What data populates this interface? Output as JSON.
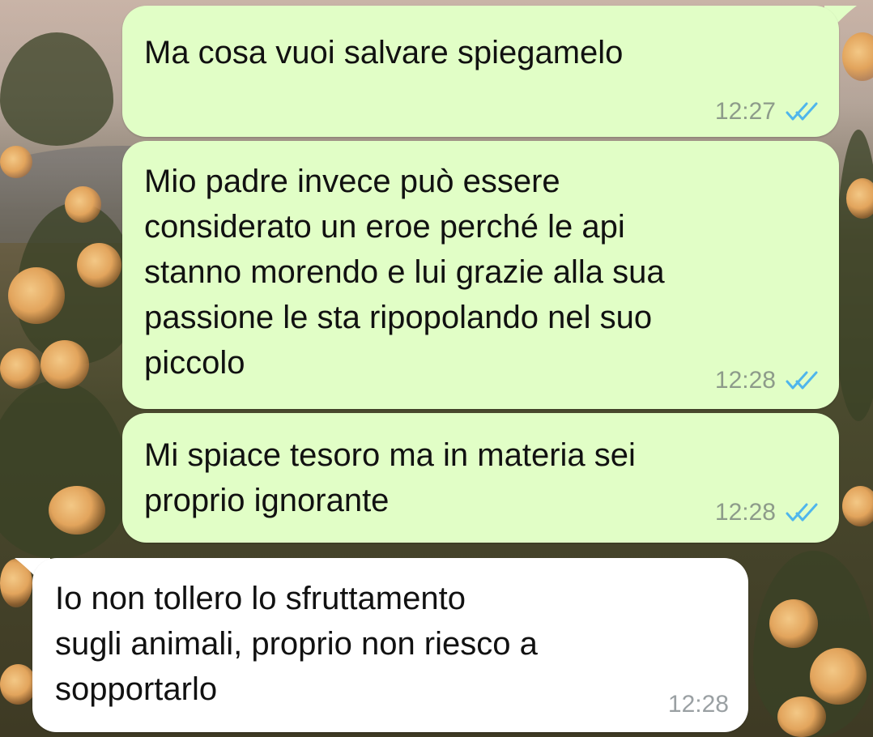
{
  "chat": {
    "messages": [
      {
        "direction": "outgoing",
        "text": "Ma cosa vuoi salvare spiegamelo",
        "time": "12:27",
        "status": "read",
        "status_icon": "double-check-icon"
      },
      {
        "direction": "outgoing",
        "text": "Mio padre invece può essere\nconsiderato un eroe perché le api\nstanno morendo e lui grazie alla sua\npassione le sta ripopolando nel suo\npiccolo",
        "time": "12:28",
        "status": "read",
        "status_icon": "double-check-icon"
      },
      {
        "direction": "outgoing",
        "text": "Mi spiace tesoro ma in materia sei\nproprio ignorante",
        "time": "12:28",
        "status": "read",
        "status_icon": "double-check-icon"
      },
      {
        "direction": "incoming",
        "text": "Io non tollero lo sfruttamento\nsugli animali, proprio non riesco a\nsopportarlo",
        "time": "12:28"
      }
    ]
  },
  "colors": {
    "outgoing_bubble": "#e1fec6",
    "incoming_bubble": "#ffffff",
    "read_tick": "#4fb6ec",
    "timestamp_outgoing": "#8d9b8a",
    "timestamp_incoming": "#9aa0a3"
  }
}
